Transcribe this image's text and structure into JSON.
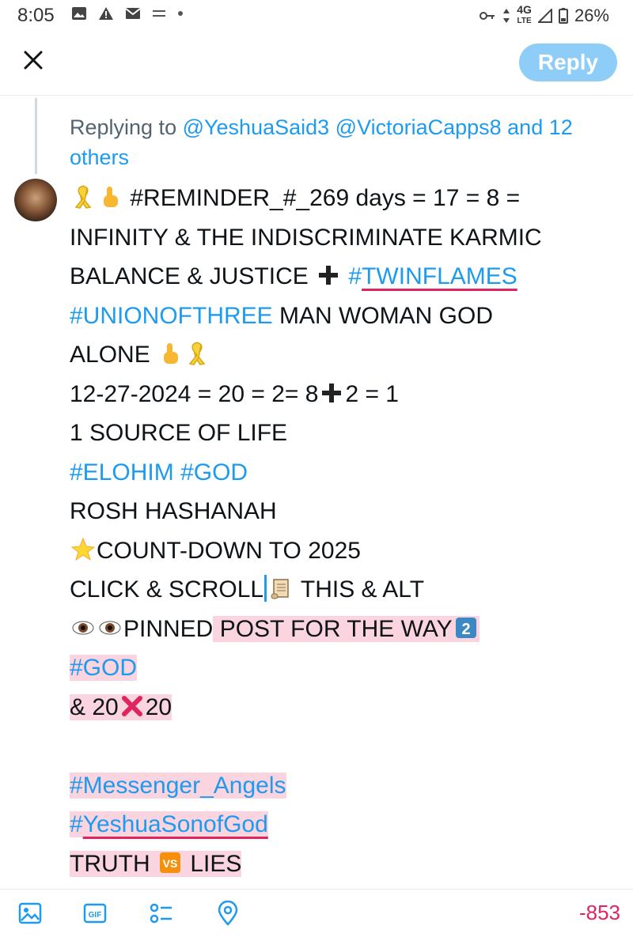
{
  "status_bar": {
    "time": "8:05",
    "network": "4G",
    "network_sub": "LTE",
    "battery": "26%"
  },
  "header": {
    "reply_label": "Reply"
  },
  "replying": {
    "prefix": "Replying to ",
    "mentions": "@YeshuaSaid3 @VictoriaCapps8 and 12",
    "mentions_cont": "others"
  },
  "post": {
    "line1": "#REMINDER_#_269 days = 17 = 8 =",
    "line2": "INFINITY & THE INDISCRIMINATE KARMIC",
    "line3_text": "BALANCE & JUSTICE ",
    "line3_tag_hash": "#",
    "line3_tag": "TWINFLAMES",
    "line4_tag": "#UNIONOFTHREE",
    "line4_text": " MAN WOMAN GOD",
    "line5_text": "ALONE ",
    "line6_a": "12-27-2024 = 20 = 2= 8",
    "line6_b": "2 = 1",
    "line7": "1 SOURCE OF LIFE",
    "line8_tag1": "#ELOHIM",
    "line8_tag2": "#GOD",
    "line9": "ROSH HASHANAH",
    "line10": "COUNT-DOWN TO 2025",
    "line11_a": "CLICK & SCROLL",
    "line11_b": " THIS & ALT",
    "line12_a": "PINNED",
    "line12_b": " POST FOR THE WAY",
    "line13_tag": "#GOD",
    "line14_a": "& 20",
    "line14_b": "20",
    "line16_tag": "#Messenger_Angels",
    "line17_hash": "#",
    "line17_tag": "YeshuaSonofGod",
    "line18_a": "TRUTH ",
    "line18_b": " LIES"
  },
  "footer": {
    "counter": "-853"
  },
  "colors": {
    "accent": "#1d9bf0",
    "reply_button": "#8ecdf7",
    "highlight": "#fad4de",
    "error": "#e0245e"
  }
}
